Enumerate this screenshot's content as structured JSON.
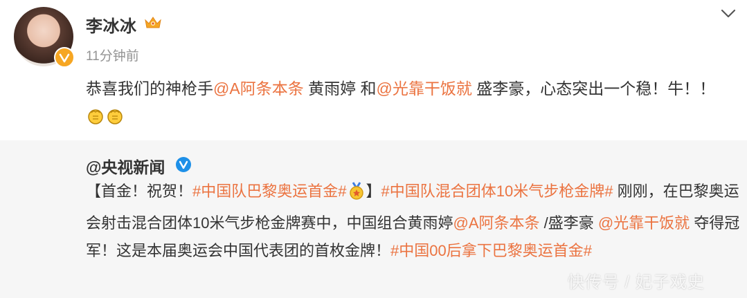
{
  "post": {
    "author": "李冰冰",
    "time": "11分钟前",
    "text_parts": {
      "p1": "恭喜我们的神枪手",
      "m1": "@A阿条本条",
      "p2": " 黄雨婷 和",
      "m2": "@光靠干饭就",
      "p3": " 盛李豪，心态突出一个稳！牛！！"
    }
  },
  "repost": {
    "author": "@央视新闻",
    "parts": {
      "a": "【首金！祝贺！",
      "t1": "#中国队巴黎奥运首金#",
      "b": "】",
      "t2": "#中国队混合团体10米气步枪金牌#",
      "c": " 刚刚，在巴黎奥运会射击混合团体10米气步枪金牌赛中，中国组合黄雨婷",
      "m1": "@A阿条本条",
      "d": " /盛李豪 ",
      "m2": "@光靠干饭就",
      "e": " 夺得冠军！这是本届奥运会中国代表团的首枚金牌！",
      "t3": "#中国00后拿下巴黎奥运首金#"
    }
  },
  "watermark": "快传号 / 妃子戏史",
  "icons": {
    "avatar": "avatar",
    "crown": "crown-icon",
    "verified_orange": "verified-badge-icon",
    "more": "chevron-down-icon",
    "clap": "clapping-hands-icon",
    "blue_v": "blue-verified-icon",
    "medal": "gold-medal-icon"
  },
  "colors": {
    "link": "#eb7340",
    "text": "#333333",
    "muted": "#939393",
    "repost_bg": "#f6f6f6",
    "orange_badge": "#f6a623",
    "blue_badge": "#1e90e8"
  }
}
